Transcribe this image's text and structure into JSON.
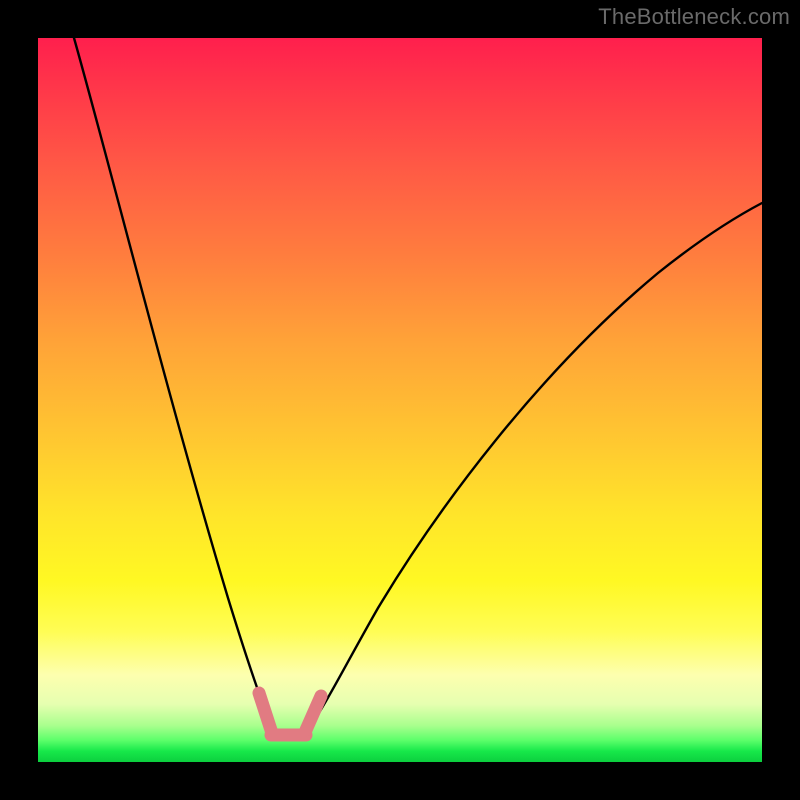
{
  "watermark": "TheBottleneck.com",
  "chart_data": {
    "type": "line",
    "title": "",
    "xlabel": "",
    "ylabel": "",
    "xlim": [
      0,
      100
    ],
    "ylim": [
      0,
      100
    ],
    "series": [
      {
        "name": "bottleneck-curve",
        "x": [
          5,
          8,
          12,
          16,
          20,
          24,
          27,
          29,
          30.5,
          32,
          33.5,
          35,
          36.5,
          40,
          45,
          52,
          60,
          70,
          82,
          95,
          100
        ],
        "y": [
          100,
          86,
          71,
          56,
          42,
          29,
          18,
          11,
          7,
          4.5,
          4,
          4.2,
          5,
          9,
          18,
          31,
          44,
          57,
          68,
          76,
          79
        ]
      }
    ],
    "annotations": [
      {
        "name": "min-marker",
        "shape": "bracket",
        "x_range": [
          30,
          37
        ],
        "y": 4.2,
        "color": "#e17b82"
      }
    ],
    "gradient_stops": [
      {
        "pos": 0.0,
        "color": "#ff1f4d"
      },
      {
        "pos": 0.3,
        "color": "#ff7d3e"
      },
      {
        "pos": 0.66,
        "color": "#ffe52a"
      },
      {
        "pos": 0.88,
        "color": "#fdffaf"
      },
      {
        "pos": 1.0,
        "color": "#0ccf3e"
      }
    ]
  }
}
